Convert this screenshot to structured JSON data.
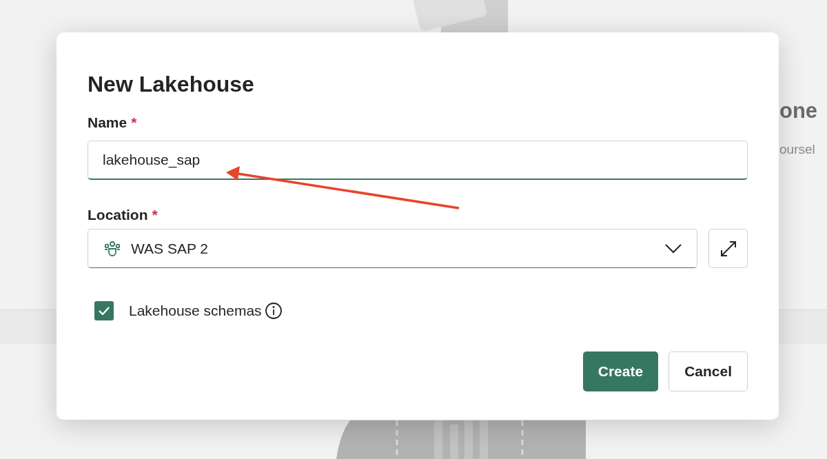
{
  "background": {
    "heading": "one",
    "subtitle": "oursel"
  },
  "dialog": {
    "title": "New Lakehouse",
    "name_field": {
      "label": "Name",
      "required_mark": "*",
      "value": "lakehouse_sap"
    },
    "location_field": {
      "label": "Location",
      "required_mark": "*",
      "value": "WAS SAP 2"
    },
    "schemas_checkbox": {
      "label": "Lakehouse schemas",
      "checked": true
    },
    "buttons": [
      {
        "label": "Create",
        "kind": "primary"
      },
      {
        "label": "Cancel",
        "kind": "secondary"
      }
    ]
  }
}
